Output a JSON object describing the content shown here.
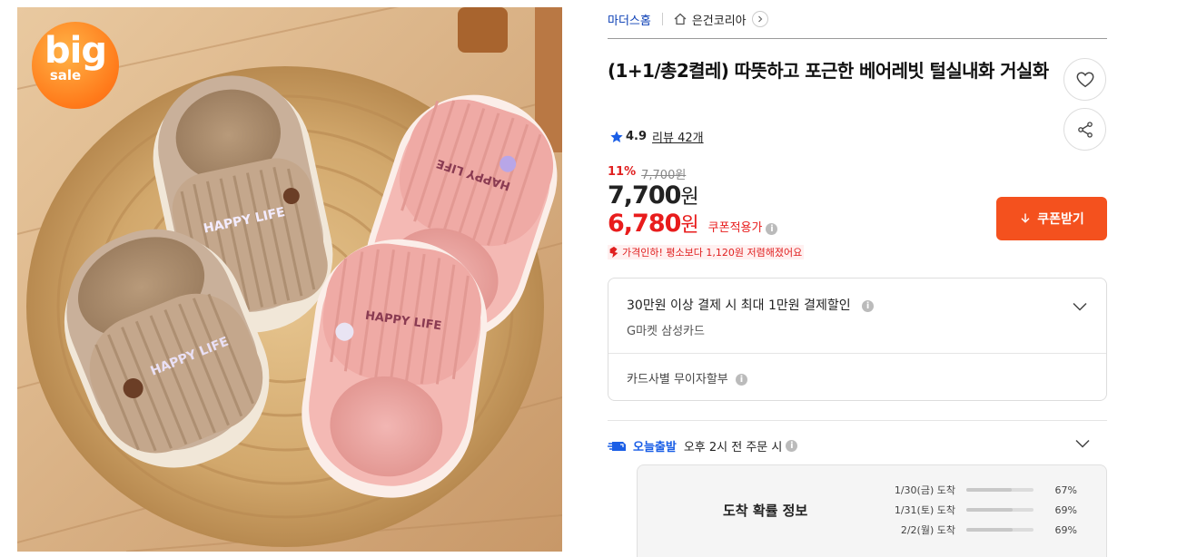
{
  "image": {
    "badge_main": "big",
    "badge_sub": "sale"
  },
  "breadcrumb": {
    "store": "마더스홈",
    "seller": "은건코리아",
    "home_icon": "home-icon",
    "arrow_icon": "chevron-right-icon"
  },
  "product": {
    "title": "(1+1/총2켤레) 따뜻하고 포근한 베어레빗 털실내화 거실화",
    "rating": "4.9",
    "reviews": "리뷰 42개",
    "discount_rate": "11%",
    "original_price": "7,700원",
    "price_value": "7,700",
    "price_unit": "원",
    "coupon_price_value": "6,780",
    "coupon_price_unit": "원",
    "coupon_applied_label": "쿠폰적용가",
    "price_drop_notice": "가격인하! 평소보다 1,120원 저렴해졌어요",
    "coupon_button": "쿠폰받기"
  },
  "card_benefit": {
    "title": "30만원 이상 결제 시 최대 1만원 결제할인",
    "subtitle": "G마켓 삼성카드",
    "installment": "카드사별 무이자할부"
  },
  "shipping": {
    "tag": "오늘출발",
    "condition": "오후 2시 전 주문 시"
  },
  "arrival": {
    "title": "도착 확률 정보",
    "rows": [
      {
        "date": "1/30(금) 도착",
        "percent": "67%",
        "level": 0.67
      },
      {
        "date": "1/31(토) 도착",
        "percent": "69%",
        "level": 0.69
      },
      {
        "date": "2/2(월) 도착",
        "percent": "69%",
        "level": 0.69
      }
    ]
  },
  "colors": {
    "accent_red": "#e81c1c",
    "coupon_orange": "#f4511e",
    "link_blue": "#0b3fb5",
    "ship_blue": "#1a5ee6"
  }
}
